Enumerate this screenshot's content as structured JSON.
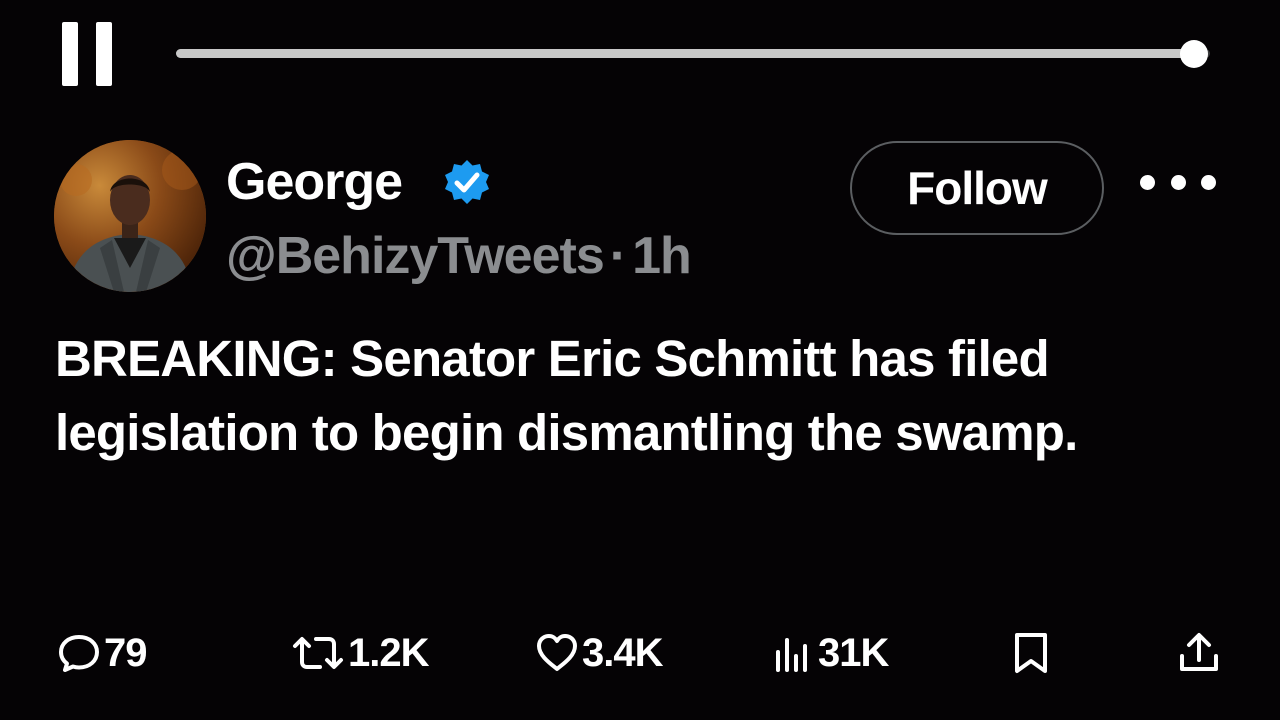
{
  "player": {
    "progress_fraction": 0.985,
    "state": "playing",
    "pause_icon": "pause-icon"
  },
  "tweet": {
    "display_name": "George",
    "verified": true,
    "verified_color": "#1d9bf0",
    "handle": "@BehizyTweets",
    "separator": "·",
    "time_ago": "1h",
    "follow_label": "Follow",
    "more_icon": "more-horizontal-icon",
    "text": "BREAKING: Senator Eric Schmitt has filed legislation to begin dismantling the swamp."
  },
  "actions": {
    "replies": "79",
    "reposts": "1.2K",
    "likes": "3.4K",
    "views": "31K",
    "icons": [
      "reply-icon",
      "repost-icon",
      "like-icon",
      "views-icon",
      "bookmark-icon",
      "share-icon"
    ]
  },
  "colors": {
    "background": "#050305",
    "text": "#ffffff",
    "muted": "#8b8d90",
    "border": "#5b5e61"
  }
}
